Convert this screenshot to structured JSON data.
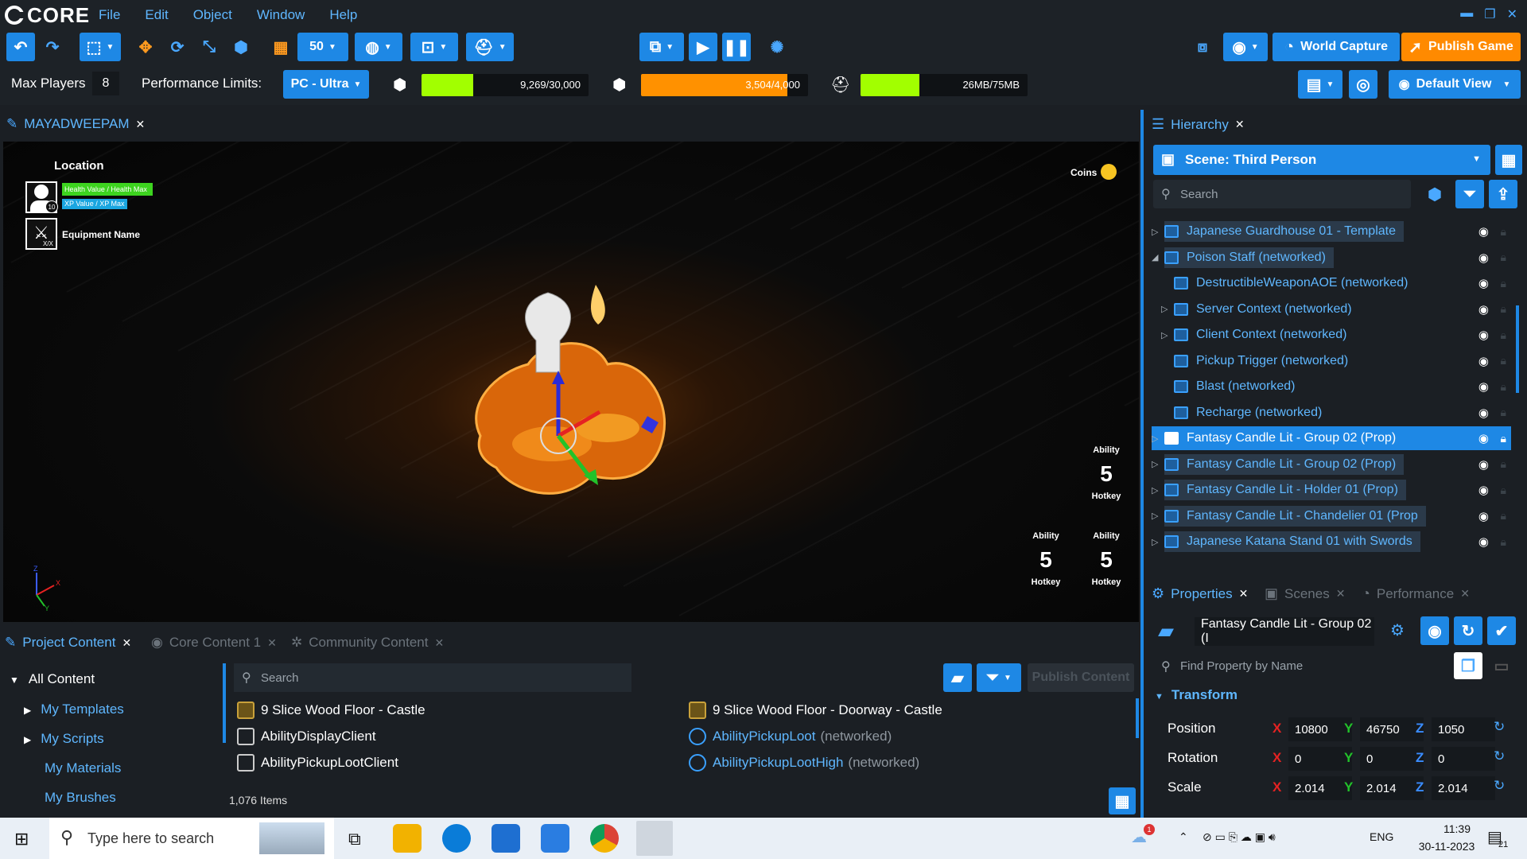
{
  "app": {
    "name": "CORE"
  },
  "menu": [
    "File",
    "Edit",
    "Object",
    "Window",
    "Help"
  ],
  "toolbar": {
    "grid_size": "50",
    "world_capture_label": "World Capture",
    "publish_label": "Publish Game",
    "default_view_label": "Default View"
  },
  "perf": {
    "max_players_label": "Max Players",
    "max_players_value": "8",
    "limits_label": "Performance Limits:",
    "limits_value": "PC - Ultra",
    "meters": [
      {
        "text": "9,269/30,000",
        "fraction": 0.31,
        "color": "#a2ff00"
      },
      {
        "text": "3,504/4,000",
        "fraction": 0.876,
        "color": "#ff9100"
      },
      {
        "text": "26MB/75MB",
        "fraction": 0.35,
        "color": "#a2ff00"
      }
    ]
  },
  "viewport": {
    "tab_label": "MAYADWEEPAM",
    "hud": {
      "location": "Location",
      "health": "Health Value / Health Max",
      "xp": "XP Value / XP Max",
      "level": "10",
      "equipment": "Equipment Name",
      "equip_count": "X/X",
      "coins": "Coins",
      "abilities": [
        {
          "label": "Ability",
          "count": "5",
          "hotkey": "Hotkey"
        },
        {
          "label": "Ability",
          "count": "5",
          "hotkey": "Hotkey"
        },
        {
          "label": "Ability",
          "count": "5",
          "hotkey": "Hotkey"
        }
      ]
    },
    "axes": {
      "z": "Z",
      "x": "X",
      "y": "Y"
    }
  },
  "hierarchy": {
    "tab_label": "Hierarchy",
    "scene_label": "Scene: Third Person",
    "search_placeholder": "Search",
    "rows": [
      {
        "label": "Japanese Guardhouse 01 - Template",
        "indent": 0,
        "expand": "▷",
        "selected": false,
        "boxed": true
      },
      {
        "label": "Poison Staff (networked)",
        "indent": 0,
        "expand": "◢",
        "selected": false,
        "boxed": true
      },
      {
        "label": "DestructibleWeaponAOE (networked)",
        "indent": 1,
        "expand": "",
        "selected": false,
        "boxed": false
      },
      {
        "label": "Server Context (networked)",
        "indent": 1,
        "expand": "▷",
        "selected": false,
        "boxed": false
      },
      {
        "label": "Client Context (networked)",
        "indent": 1,
        "expand": "▷",
        "selected": false,
        "boxed": false
      },
      {
        "label": "Pickup Trigger (networked)",
        "indent": 1,
        "expand": "",
        "selected": false,
        "boxed": false
      },
      {
        "label": "Blast (networked)",
        "indent": 1,
        "expand": "",
        "selected": false,
        "boxed": false
      },
      {
        "label": "Recharge (networked)",
        "indent": 1,
        "expand": "",
        "selected": false,
        "boxed": false
      },
      {
        "label": "Fantasy Candle Lit - Group 02 (Prop)",
        "indent": 0,
        "expand": "▷",
        "selected": true,
        "boxed": false
      },
      {
        "label": "Fantasy Candle Lit - Group 02 (Prop)",
        "indent": 0,
        "expand": "▷",
        "selected": false,
        "boxed": true
      },
      {
        "label": "Fantasy Candle Lit - Holder 01 (Prop)",
        "indent": 0,
        "expand": "▷",
        "selected": false,
        "boxed": true
      },
      {
        "label": "Fantasy Candle Lit - Chandelier 01 (Prop",
        "indent": 0,
        "expand": "▷",
        "selected": false,
        "boxed": true
      },
      {
        "label": "Japanese Katana Stand 01 with Swords",
        "indent": 0,
        "expand": "▷",
        "selected": false,
        "boxed": true
      }
    ]
  },
  "properties": {
    "tabs": [
      "Properties",
      "Scenes",
      "Performance"
    ],
    "object_name": "Fantasy Candle Lit - Group 02 (I",
    "find_placeholder": "Find Property by Name",
    "transform_label": "Transform",
    "position": {
      "label": "Position",
      "x": "10800",
      "y": "46750",
      "z": "1050"
    },
    "rotation": {
      "label": "Rotation",
      "x": "0",
      "y": "0",
      "z": "0"
    },
    "scale": {
      "label": "Scale",
      "x": "2.014",
      "y": "2.014",
      "z": "2.014"
    },
    "x_label": "X",
    "y_label": "Y",
    "z_label": "Z"
  },
  "content": {
    "tabs": [
      "Project Content",
      "Core Content 1",
      "Community Content"
    ],
    "tree_root": "All Content",
    "tree": [
      "My Templates",
      "My Scripts",
      "My Materials",
      "My Brushes"
    ],
    "search_placeholder": "Search",
    "publish_content": "Publish Content",
    "items_left": [
      {
        "name": "9 Slice Wood Floor - Castle",
        "suffix": ""
      },
      {
        "name": "AbilityDisplayClient",
        "suffix": ""
      },
      {
        "name": "AbilityPickupLootClient",
        "suffix": ""
      }
    ],
    "items_right": [
      {
        "name": "9 Slice Wood Floor - Doorway - Castle",
        "suffix": ""
      },
      {
        "name": "AbilityPickupLoot",
        "suffix": "(networked)"
      },
      {
        "name": "AbilityPickupLootHigh",
        "suffix": "(networked)"
      }
    ],
    "count": "1,076 Items"
  },
  "taskbar": {
    "search_placeholder": "Type here to search",
    "lang": "ENG",
    "time": "11:39",
    "date": "30-11-2023",
    "notif_count": "21",
    "weather_badge": "1"
  },
  "colors": {
    "accent": "#1e88e5",
    "link": "#5fb7ff",
    "publish": "#ff8a00",
    "bg": "#1b1f24"
  }
}
